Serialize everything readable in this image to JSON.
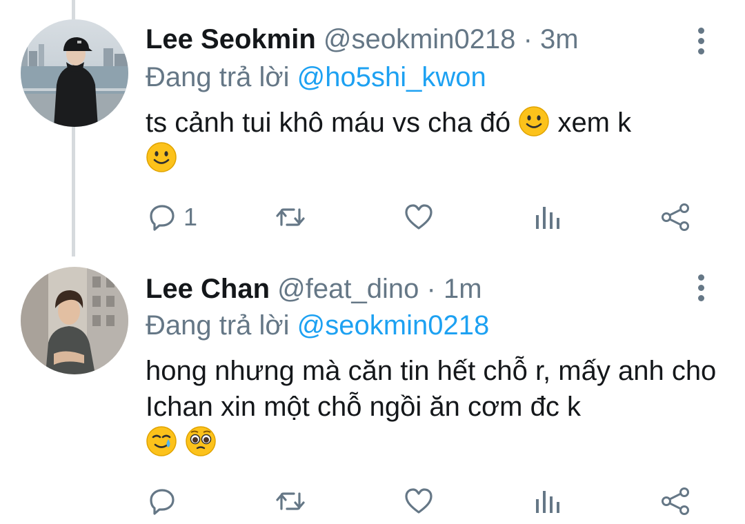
{
  "tweets": [
    {
      "name": "Lee Seokmin",
      "handle": "@seokmin0218",
      "dot": "·",
      "time": "3m",
      "reply_prefix": "Đang trả lời",
      "reply_to": "@ho5shi_kwon",
      "text_part1": "ts cảnh tui khô máu vs cha đó",
      "text_part2": "xem k",
      "emoji": [
        "slightly-smiling-face",
        "slightly-smiling-face"
      ],
      "reply_count": "1"
    },
    {
      "name": "Lee Chan",
      "handle": "@feat_dino",
      "dot": "·",
      "time": "1m",
      "reply_prefix": "Đang trả lời",
      "reply_to": "@seokmin0218",
      "text": "hong nhưng mà căn tin hết chỗ r, mấy anh cho Ichan xin một chỗ ngồi ăn cơm đc k",
      "emoji": [
        "smiling-face-with-tear",
        "pleading-face"
      ],
      "reply_count": ""
    }
  ],
  "icons": {
    "reply": "reply-icon",
    "retweet": "retweet-icon",
    "like": "heart-icon",
    "stats": "stats-icon",
    "share": "share-icon",
    "more": "more-vertical-icon"
  },
  "colors": {
    "mention": "#1da1f2",
    "secondary_text": "#657786",
    "thread_line": "#d6dadd"
  }
}
